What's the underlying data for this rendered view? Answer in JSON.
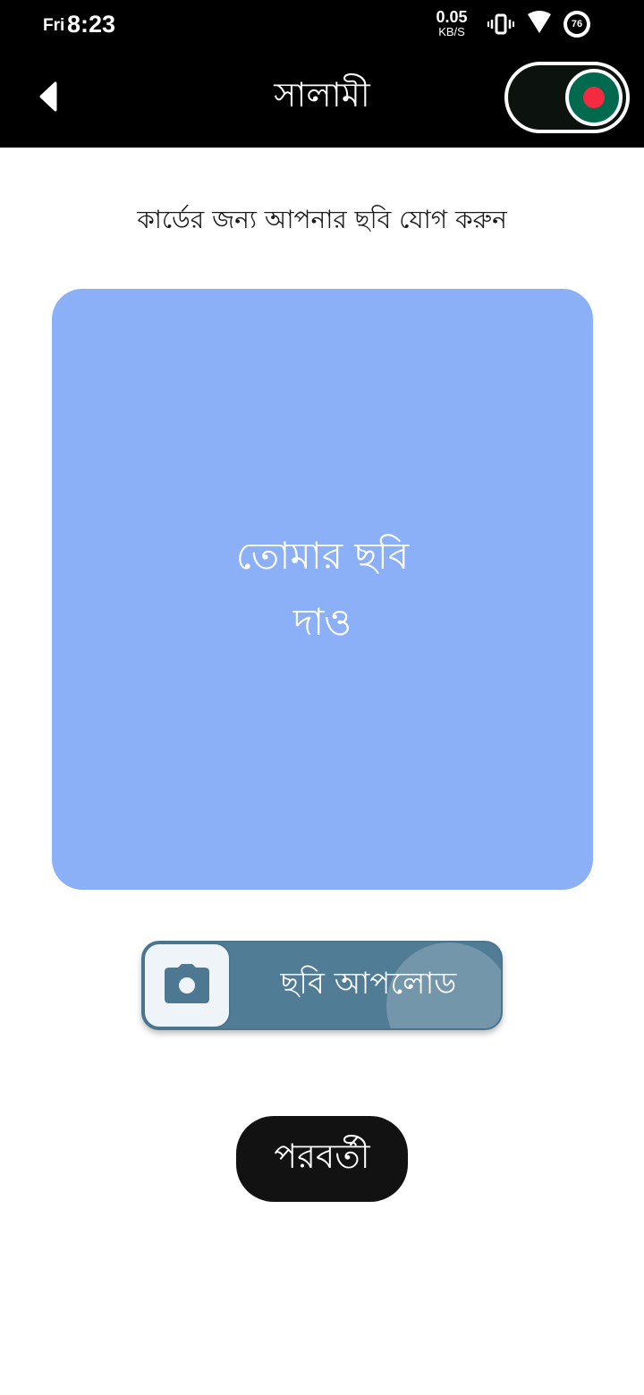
{
  "status_bar": {
    "day": "Fri",
    "time": "8:23",
    "net_speed_value": "0.05",
    "net_speed_unit": "KB/S",
    "battery": "76",
    "icons": [
      "vibrate-icon",
      "wifi-icon",
      "battery-icon"
    ]
  },
  "app_bar": {
    "title": "সালামী",
    "back_icon": "back-arrow-icon",
    "toggle_icon": "bangladesh-flag-icon",
    "toggle_on": true
  },
  "instruction": "কার্ডের জন্য আপনার ছবি যোগ করুন",
  "photo_placeholder": {
    "line1": "তোমার ছবি",
    "line2": "দাও"
  },
  "upload_button": {
    "label": "ছবি আপলোড",
    "icon": "camera-icon"
  },
  "next_button": {
    "label": "পরবর্তী"
  },
  "colors": {
    "bar_background": "#000000",
    "photo_box": "#8bb0f7",
    "upload_button": "#517c96",
    "upload_icon_bg": "#eff4f9",
    "next_button": "#121212",
    "flag_green": "#006a4e",
    "flag_red": "#f42a41"
  }
}
